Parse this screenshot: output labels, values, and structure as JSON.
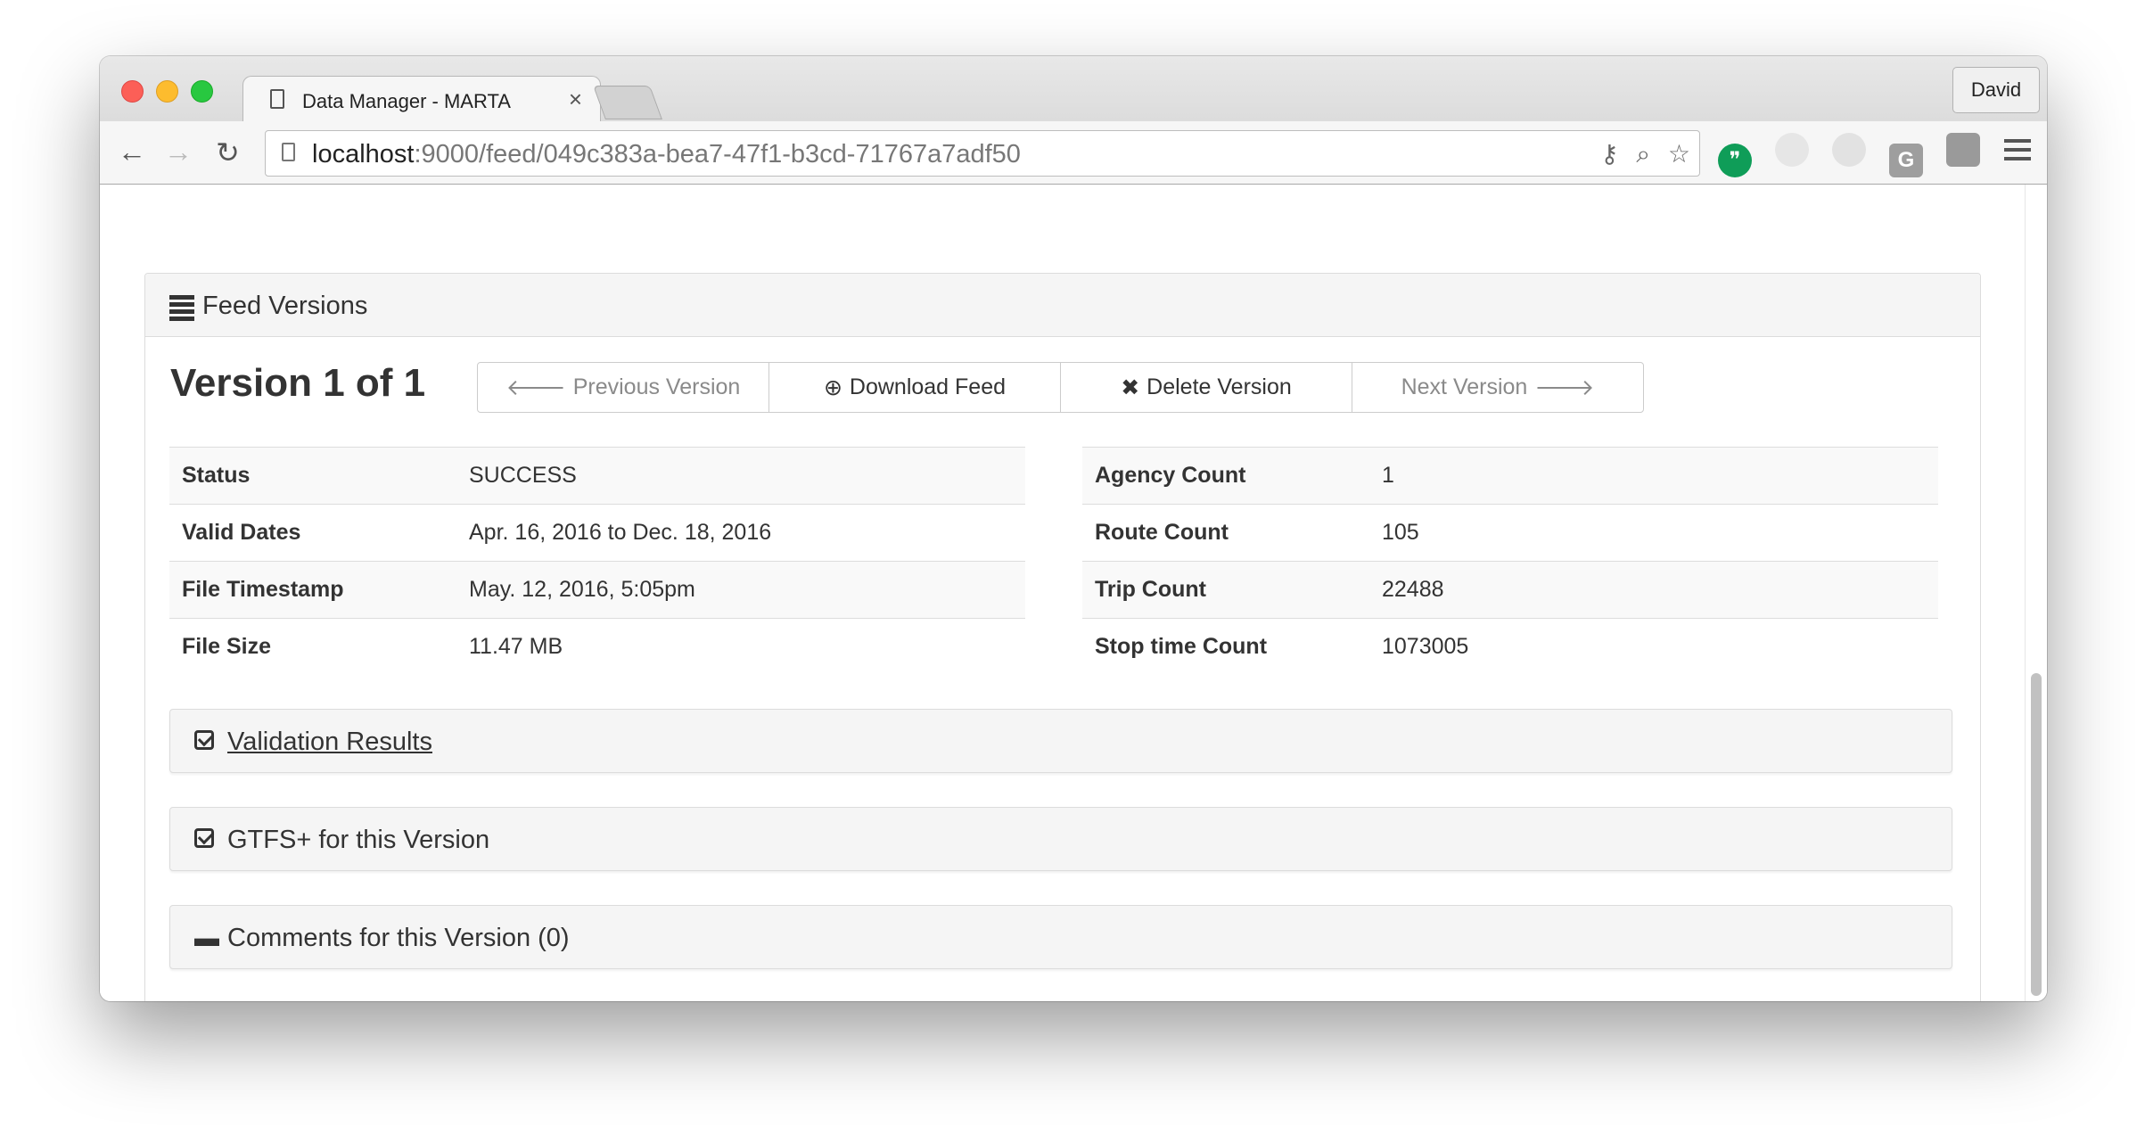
{
  "browser": {
    "tab_title": "Data Manager - MARTA",
    "tab_close": "×",
    "profile": "David",
    "url_host": "localhost",
    "url_rest": ":9000/feed/049c383a-bea7-47f1-b3cd-71767a7adf50",
    "icons": {
      "back": "←",
      "forward": "→",
      "reload": "↻",
      "key": "⚷",
      "zoom": "⌕",
      "star": "☆"
    },
    "extensions": {
      "hangouts": "❞",
      "g": "G"
    }
  },
  "panel": {
    "title": "Feed Versions",
    "version_title": "Version 1 of 1",
    "buttons": {
      "previous": "Previous Version",
      "previous_icon": "🡐",
      "download": "Download Feed",
      "download_icon": "⊕",
      "delete": "Delete Version",
      "delete_icon": "✖",
      "next": "Next Version",
      "next_icon": "🡒"
    },
    "left_table": [
      {
        "label": "Status",
        "value": "SUCCESS"
      },
      {
        "label": "Valid Dates",
        "value": "Apr. 16, 2016 to Dec. 18, 2016"
      },
      {
        "label": "File Timestamp",
        "value": "May. 12, 2016, 5:05pm"
      },
      {
        "label": "File Size",
        "value": "11.47 MB"
      }
    ],
    "right_table": [
      {
        "label": "Agency Count",
        "value": "1"
      },
      {
        "label": "Route Count",
        "value": "105"
      },
      {
        "label": "Trip Count",
        "value": "22488"
      },
      {
        "label": "Stop time Count",
        "value": "1073005"
      }
    ],
    "sections": {
      "validation": " Validation Results",
      "gtfs_plus": "GTFS+ for this Version",
      "comments": "Comments for this Version (0)",
      "comment_icon": "▬"
    }
  }
}
